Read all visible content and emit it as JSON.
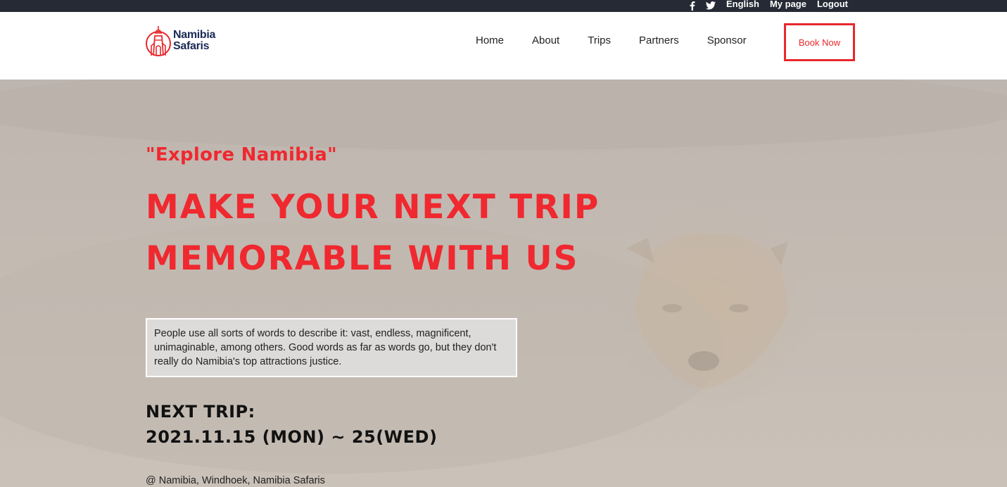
{
  "topbar": {
    "icons": [
      "facebook-icon",
      "twitter-icon"
    ],
    "links": [
      "English",
      "My page",
      "Logout"
    ]
  },
  "header": {
    "logo_line1": "Namibia",
    "logo_line2": "Safaris",
    "nav": [
      "Home",
      "About",
      "Trips",
      "Partners",
      "Sponsor"
    ],
    "book_label": "Book Now"
  },
  "hero": {
    "tagline": "\"Explore Namibia\"",
    "title_line1": "MAKE YOUR NEXT TRIP",
    "title_line2": "MEMORABLE WITH US",
    "description": "People use all sorts of words to describe it: vast, endless, magnificent, unimaginable, among others. Good words as far as words go, but they don't really do Namibia's top attractions justice.",
    "next_trip_label": "NEXT TRIP:",
    "next_trip_date": "2021.11.15 (MON) ~ 25(WED)",
    "location": "@ Namibia, Windhoek, Namibia Safaris"
  },
  "colors": {
    "accent": "#e8282c",
    "topbar": "#252a35",
    "logo": "#1b2a55"
  }
}
